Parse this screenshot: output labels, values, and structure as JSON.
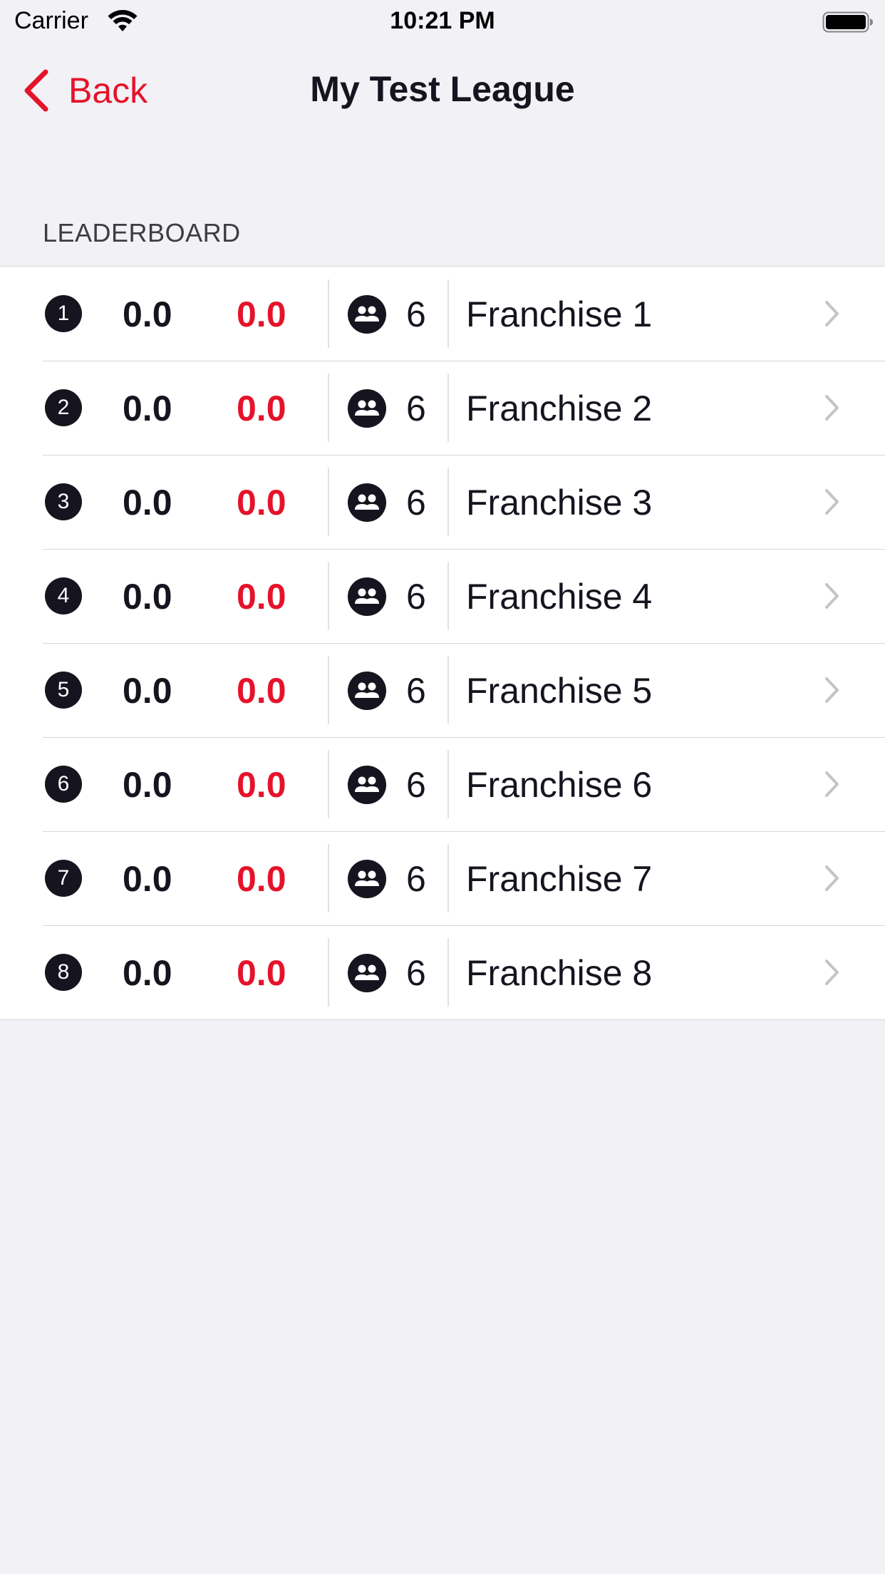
{
  "status_bar": {
    "carrier": "Carrier",
    "time": "10:21 PM"
  },
  "nav": {
    "back_label": "Back",
    "title": "My Test League"
  },
  "leaderboard": {
    "section_header": "LEADERBOARD",
    "colors": {
      "accent": "#E5132A",
      "primary": "#15141F"
    },
    "rows": [
      {
        "rank": "1",
        "score": "0.0",
        "score_secondary": "0.0",
        "members": "6",
        "name": "Franchise 1"
      },
      {
        "rank": "2",
        "score": "0.0",
        "score_secondary": "0.0",
        "members": "6",
        "name": "Franchise 2"
      },
      {
        "rank": "3",
        "score": "0.0",
        "score_secondary": "0.0",
        "members": "6",
        "name": "Franchise 3"
      },
      {
        "rank": "4",
        "score": "0.0",
        "score_secondary": "0.0",
        "members": "6",
        "name": "Franchise 4"
      },
      {
        "rank": "5",
        "score": "0.0",
        "score_secondary": "0.0",
        "members": "6",
        "name": "Franchise 5"
      },
      {
        "rank": "6",
        "score": "0.0",
        "score_secondary": "0.0",
        "members": "6",
        "name": "Franchise 6"
      },
      {
        "rank": "7",
        "score": "0.0",
        "score_secondary": "0.0",
        "members": "6",
        "name": "Franchise 7"
      },
      {
        "rank": "8",
        "score": "0.0",
        "score_secondary": "0.0",
        "members": "6",
        "name": "Franchise 8"
      }
    ]
  }
}
